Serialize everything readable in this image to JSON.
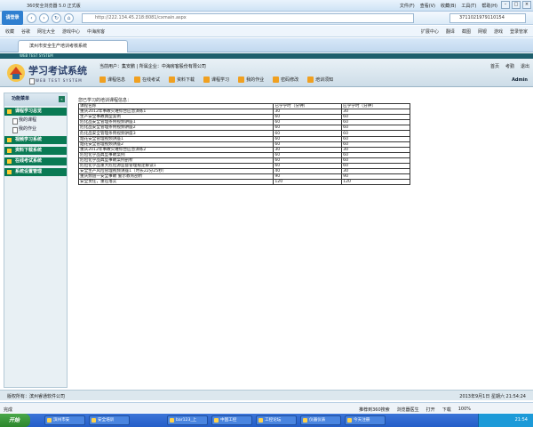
{
  "browser": {
    "title": "360安全浏览器 5.0 正式版",
    "login": "请登录",
    "menus": [
      "文件(F)",
      "查看(V)",
      "收藏(B)",
      "工具(T)",
      "帮助(H)"
    ],
    "url": "http://222.134.45.218:8081/cxmain.aspx",
    "search": "3711021979110154",
    "favorites": [
      "收藏",
      "谷歌",
      "网址大全",
      "游戏中心",
      "中海房客"
    ],
    "right_tools": [
      "扩展中心",
      "翻译",
      "截图",
      "网银",
      "游戏",
      "登录管家"
    ],
    "tab_title": "滨州市安全生产培训考核系统",
    "status_left": "完成",
    "status_items": [
      "推荐到360搜索",
      "浏览器医生",
      "打开",
      "下载",
      "100%"
    ]
  },
  "app": {
    "banner": "WEB TEST SYSTEM",
    "logo_title": "学习考试系统",
    "logo_sub": "WEB TEST SYSTEM",
    "user_line": "当前用户：集安鹏 | 所属企业：中海房客股份有限公司",
    "top_links": [
      "首页",
      "考勤",
      "退出"
    ],
    "nav": [
      "课程信息",
      "在线考试",
      "资料下载",
      "课程学习",
      "我的作业",
      "密码修改",
      "培训须知"
    ],
    "admin": "Admin"
  },
  "sidebar": {
    "title": "功能菜单",
    "sections": [
      {
        "label": "课程学习总览",
        "items": [
          "我的课程",
          "我的作业"
        ]
      },
      {
        "label": "视频学习系统",
        "items": []
      },
      {
        "label": "资料下载系统",
        "items": []
      },
      {
        "label": "在线考试系统",
        "items": []
      },
      {
        "label": "系统设置管理",
        "items": []
      }
    ]
  },
  "content": {
    "caption": "您已学习的培训课程信息：",
    "columns": [
      "课程名称",
      "已学学时（分钟）",
      "应学学时（分钟）"
    ],
    "rows": [
      [
        "重庆2012年事故灾难综合应急演练1",
        "30",
        "30"
      ],
      [
        "生产安全事故典型案例",
        "60",
        "60"
      ],
      [
        "危化品安全管理条例视频讲座1",
        "60",
        "60"
      ],
      [
        "危化品安全管理条例视频讲座2",
        "60",
        "60"
      ],
      [
        "危化品安全管理条例视频讲座3",
        "60",
        "60"
      ],
      [
        "烟花安全管理视频讲座1",
        "60",
        "60"
      ],
      [
        "烟花安全管理视频讲座2",
        "60",
        "60"
      ],
      [
        "重庆2012年事故灾难综合应急演练2",
        "30",
        "30"
      ],
      [
        "危险化学品典型事故案例",
        "60",
        "60"
      ],
      [
        "危险化学品典型事故案例剖析",
        "60",
        "60"
      ],
      [
        "危险化学品重大危险源监督管理规定解读1",
        "60",
        "60"
      ],
      [
        "安全生产风险管理视频讲座1（时长22分25秒）",
        "40",
        "30"
      ],
      [
        "重庆频道一安全事故 警示教育剖析",
        "90",
        "90"
      ],
      [
        "安全责任，重在落实",
        "120",
        "120"
      ]
    ]
  },
  "footer": {
    "copyright": "版权所有：滨州睿通软件公司",
    "datetime": "2013年9月1日 星期六 21:54:24"
  },
  "taskbar": {
    "start": "开始",
    "items": [
      "滨州市安",
      "安全培训",
      "bar123_上",
      "中国工控",
      "工控论坛",
      "仪器仪表",
      "今天注册"
    ],
    "clock": "21:54"
  }
}
